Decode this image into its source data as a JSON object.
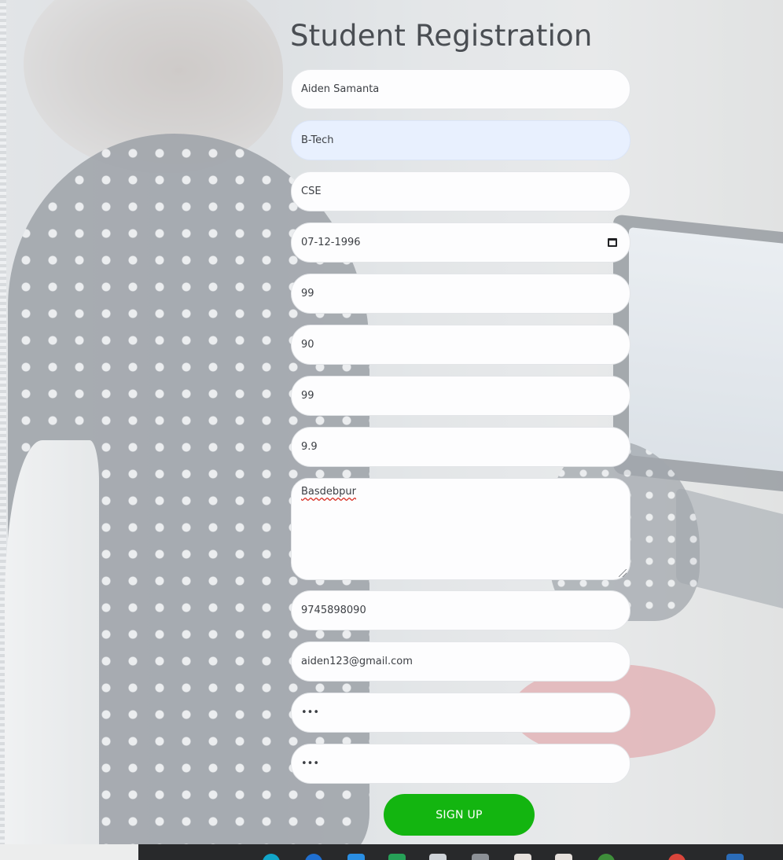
{
  "page": {
    "title": "Student Registration"
  },
  "form": {
    "name": "Aiden Samanta",
    "course": "B-Tech",
    "branch": "CSE",
    "dob": "07-12-1996",
    "field5": "99",
    "field6": "90",
    "field7": "99",
    "field8": "9.9",
    "address": "Basdebpur",
    "phone": "9745898090",
    "email": "aiden123@gmail.com",
    "password": "•••",
    "confirm_password": "•••",
    "submit_label": "SIGN UP"
  },
  "colors": {
    "submit_button": "#13b510",
    "title_text": "#4a4e53",
    "autofill_field": "#e8f0fe"
  },
  "taskbar": {
    "icons": [
      "edge-icon",
      "browser-icon",
      "store-icon",
      "excel-icon",
      "folder-icon",
      "mail-icon",
      "pdf-icon",
      "pdf-icon-2",
      "settings-icon",
      "chrome-icon",
      "vscode-icon"
    ]
  }
}
